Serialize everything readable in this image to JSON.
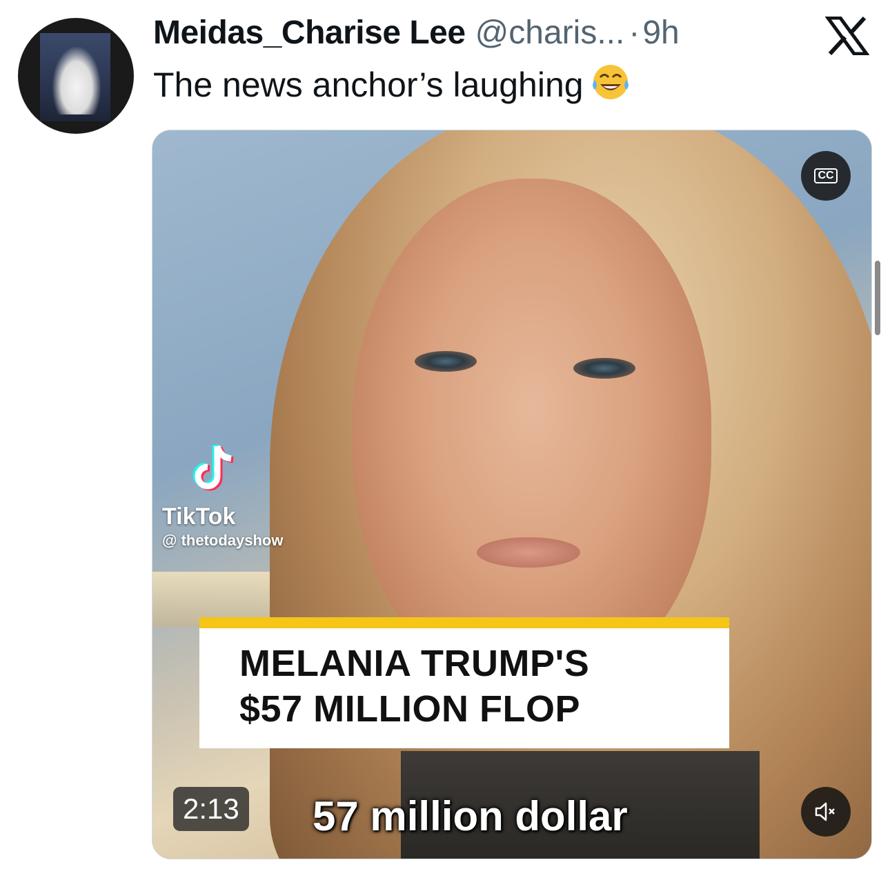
{
  "tweet": {
    "display_name": "Meidas_Charise Lee",
    "handle": "@charis...",
    "separator": "·",
    "time": "9h",
    "text": "The news anchor’s laughing",
    "emoji": "face-with-tears-of-joy",
    "platform_logo": "x-logo-icon"
  },
  "media": {
    "cc_label": "CC",
    "watermark": {
      "brand": "TikTok",
      "handle": "@ thetodayshow"
    },
    "banner": {
      "line1": "MELANIA TRUMP'S",
      "line2": "$57 MILLION FLOP",
      "accent_color": "#f5c518"
    },
    "duration": "2:13",
    "subtitle": "57 million dollar",
    "sound": "muted"
  },
  "colors": {
    "text_primary": "#0f1419",
    "text_secondary": "#536471"
  }
}
